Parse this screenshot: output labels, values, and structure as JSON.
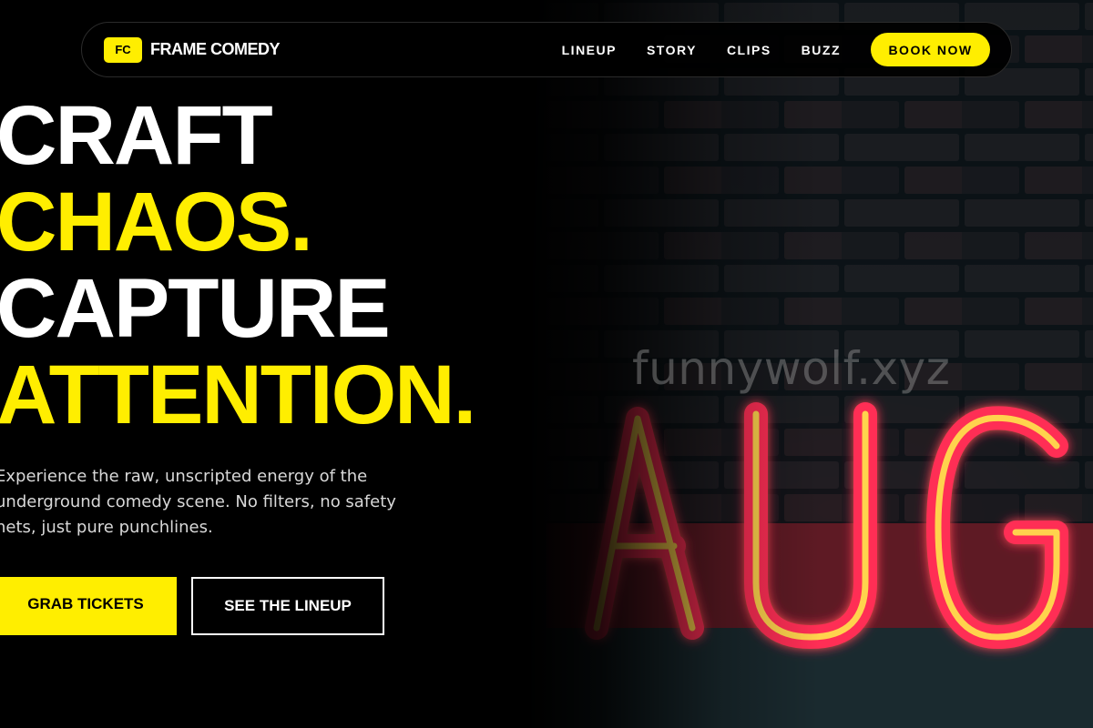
{
  "brand": {
    "mark": "FC",
    "name": "FRAME COMEDY"
  },
  "nav": {
    "items": [
      "LINEUP",
      "STORY",
      "CLIPS",
      "BUZZ"
    ],
    "cta": "BOOK NOW"
  },
  "hero": {
    "lines": [
      "CRAFT",
      "CHAOS.",
      "CAPTURE",
      "ATTENTION."
    ],
    "lead": "Experience the raw, unscripted energy of the underground comedy scene. No filters, no safety nets, just pure punchlines.",
    "primary_cta": "GRAB TICKETS",
    "secondary_cta": "SEE THE LINEUP",
    "image_sign": "AUG",
    "watermark": "funnywolf.xyz"
  },
  "colors": {
    "accent": "#ffee00",
    "background": "#000000",
    "neon": "#ff2d55",
    "neon_core": "#ffd34d"
  },
  "icons": {
    "hero_image": "neon-sign-photo"
  }
}
